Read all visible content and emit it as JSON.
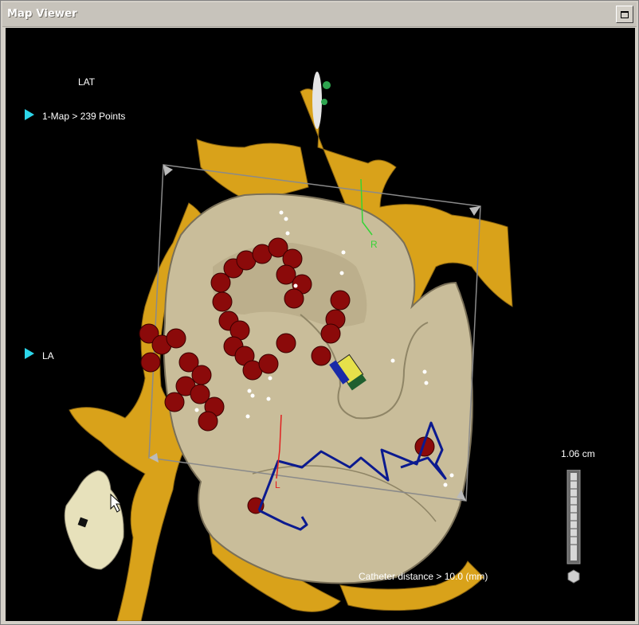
{
  "window": {
    "title": "Map Viewer"
  },
  "overlay": {
    "map_type": "LAT",
    "map_entry": "1-Map > 239 Points",
    "chamber": "LA",
    "scale_label": "1.06 cm",
    "catheter_distance": "Catheter distance > 10.0 (mm)",
    "axis_r": "R",
    "axis_l": "L"
  },
  "icons": {
    "maximize": "maximize-icon",
    "expand_map": "triangle-right-icon",
    "expand_chamber": "triangle-right-icon",
    "cursor": "mouse-pointer-icon",
    "scale_reset": "hexagon-icon"
  },
  "colors": {
    "viewport_bg": "#000000",
    "anatomy_vessels": "#d9a21a",
    "chamber_surface": "#c9bd9a",
    "ablation_tags": "#8b0a0a",
    "catheter_path": "#0b1a8f",
    "accent_triangle": "#2cd6ea"
  }
}
